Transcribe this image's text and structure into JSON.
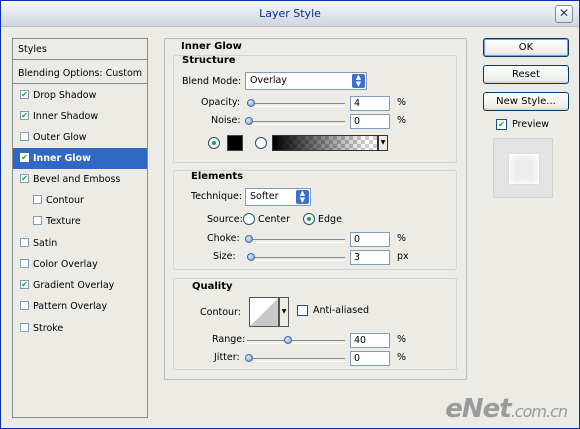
{
  "window": {
    "title": "Layer Style",
    "close_icon": "close-icon"
  },
  "styles_panel": {
    "header": "Styles",
    "items": [
      {
        "label": "Blending Options: Custom",
        "checkbox": false
      },
      {
        "label": "Drop Shadow",
        "checkbox": true,
        "checked": true
      },
      {
        "label": "Inner Shadow",
        "checkbox": true,
        "checked": true
      },
      {
        "label": "Outer Glow",
        "checkbox": true,
        "checked": false
      },
      {
        "label": "Inner Glow",
        "checkbox": true,
        "checked": true,
        "selected": true
      },
      {
        "label": "Bevel and Emboss",
        "checkbox": true,
        "checked": true
      },
      {
        "label": "Contour",
        "checkbox": true,
        "checked": false
      },
      {
        "label": "Texture",
        "checkbox": true,
        "checked": false
      },
      {
        "label": "Satin",
        "checkbox": true,
        "checked": false
      },
      {
        "label": "Color Overlay",
        "checkbox": true,
        "checked": false
      },
      {
        "label": "Gradient Overlay",
        "checkbox": true,
        "checked": true
      },
      {
        "label": "Pattern Overlay",
        "checkbox": true,
        "checked": false
      },
      {
        "label": "Stroke",
        "checkbox": true,
        "checked": false
      }
    ]
  },
  "inner_glow": {
    "title": "Inner Glow",
    "structure": {
      "title": "Structure",
      "blend_mode_label": "Blend Mode:",
      "blend_mode_value": "Overlay",
      "opacity_label": "Opacity:",
      "opacity_value": "4",
      "opacity_unit": "%",
      "noise_label": "Noise:",
      "noise_value": "0",
      "noise_unit": "%",
      "color_swatch": "#000000"
    },
    "elements": {
      "title": "Elements",
      "technique_label": "Technique:",
      "technique_value": "Softer",
      "source_label": "Source:",
      "source_center": "Center",
      "source_edge": "Edge",
      "choke_label": "Choke:",
      "choke_value": "0",
      "choke_unit": "%",
      "size_label": "Size:",
      "size_value": "3",
      "size_unit": "px"
    },
    "quality": {
      "title": "Quality",
      "contour_label": "Contour:",
      "anti_aliased_label": "Anti-aliased",
      "range_label": "Range:",
      "range_value": "40",
      "range_unit": "%",
      "jitter_label": "Jitter:",
      "jitter_value": "0",
      "jitter_unit": "%"
    }
  },
  "buttons": {
    "ok": "OK",
    "reset": "Reset",
    "new_style": "New Style...",
    "preview": "Preview"
  },
  "watermark": {
    "main": "eNet",
    "suffix": ".com.cn"
  }
}
